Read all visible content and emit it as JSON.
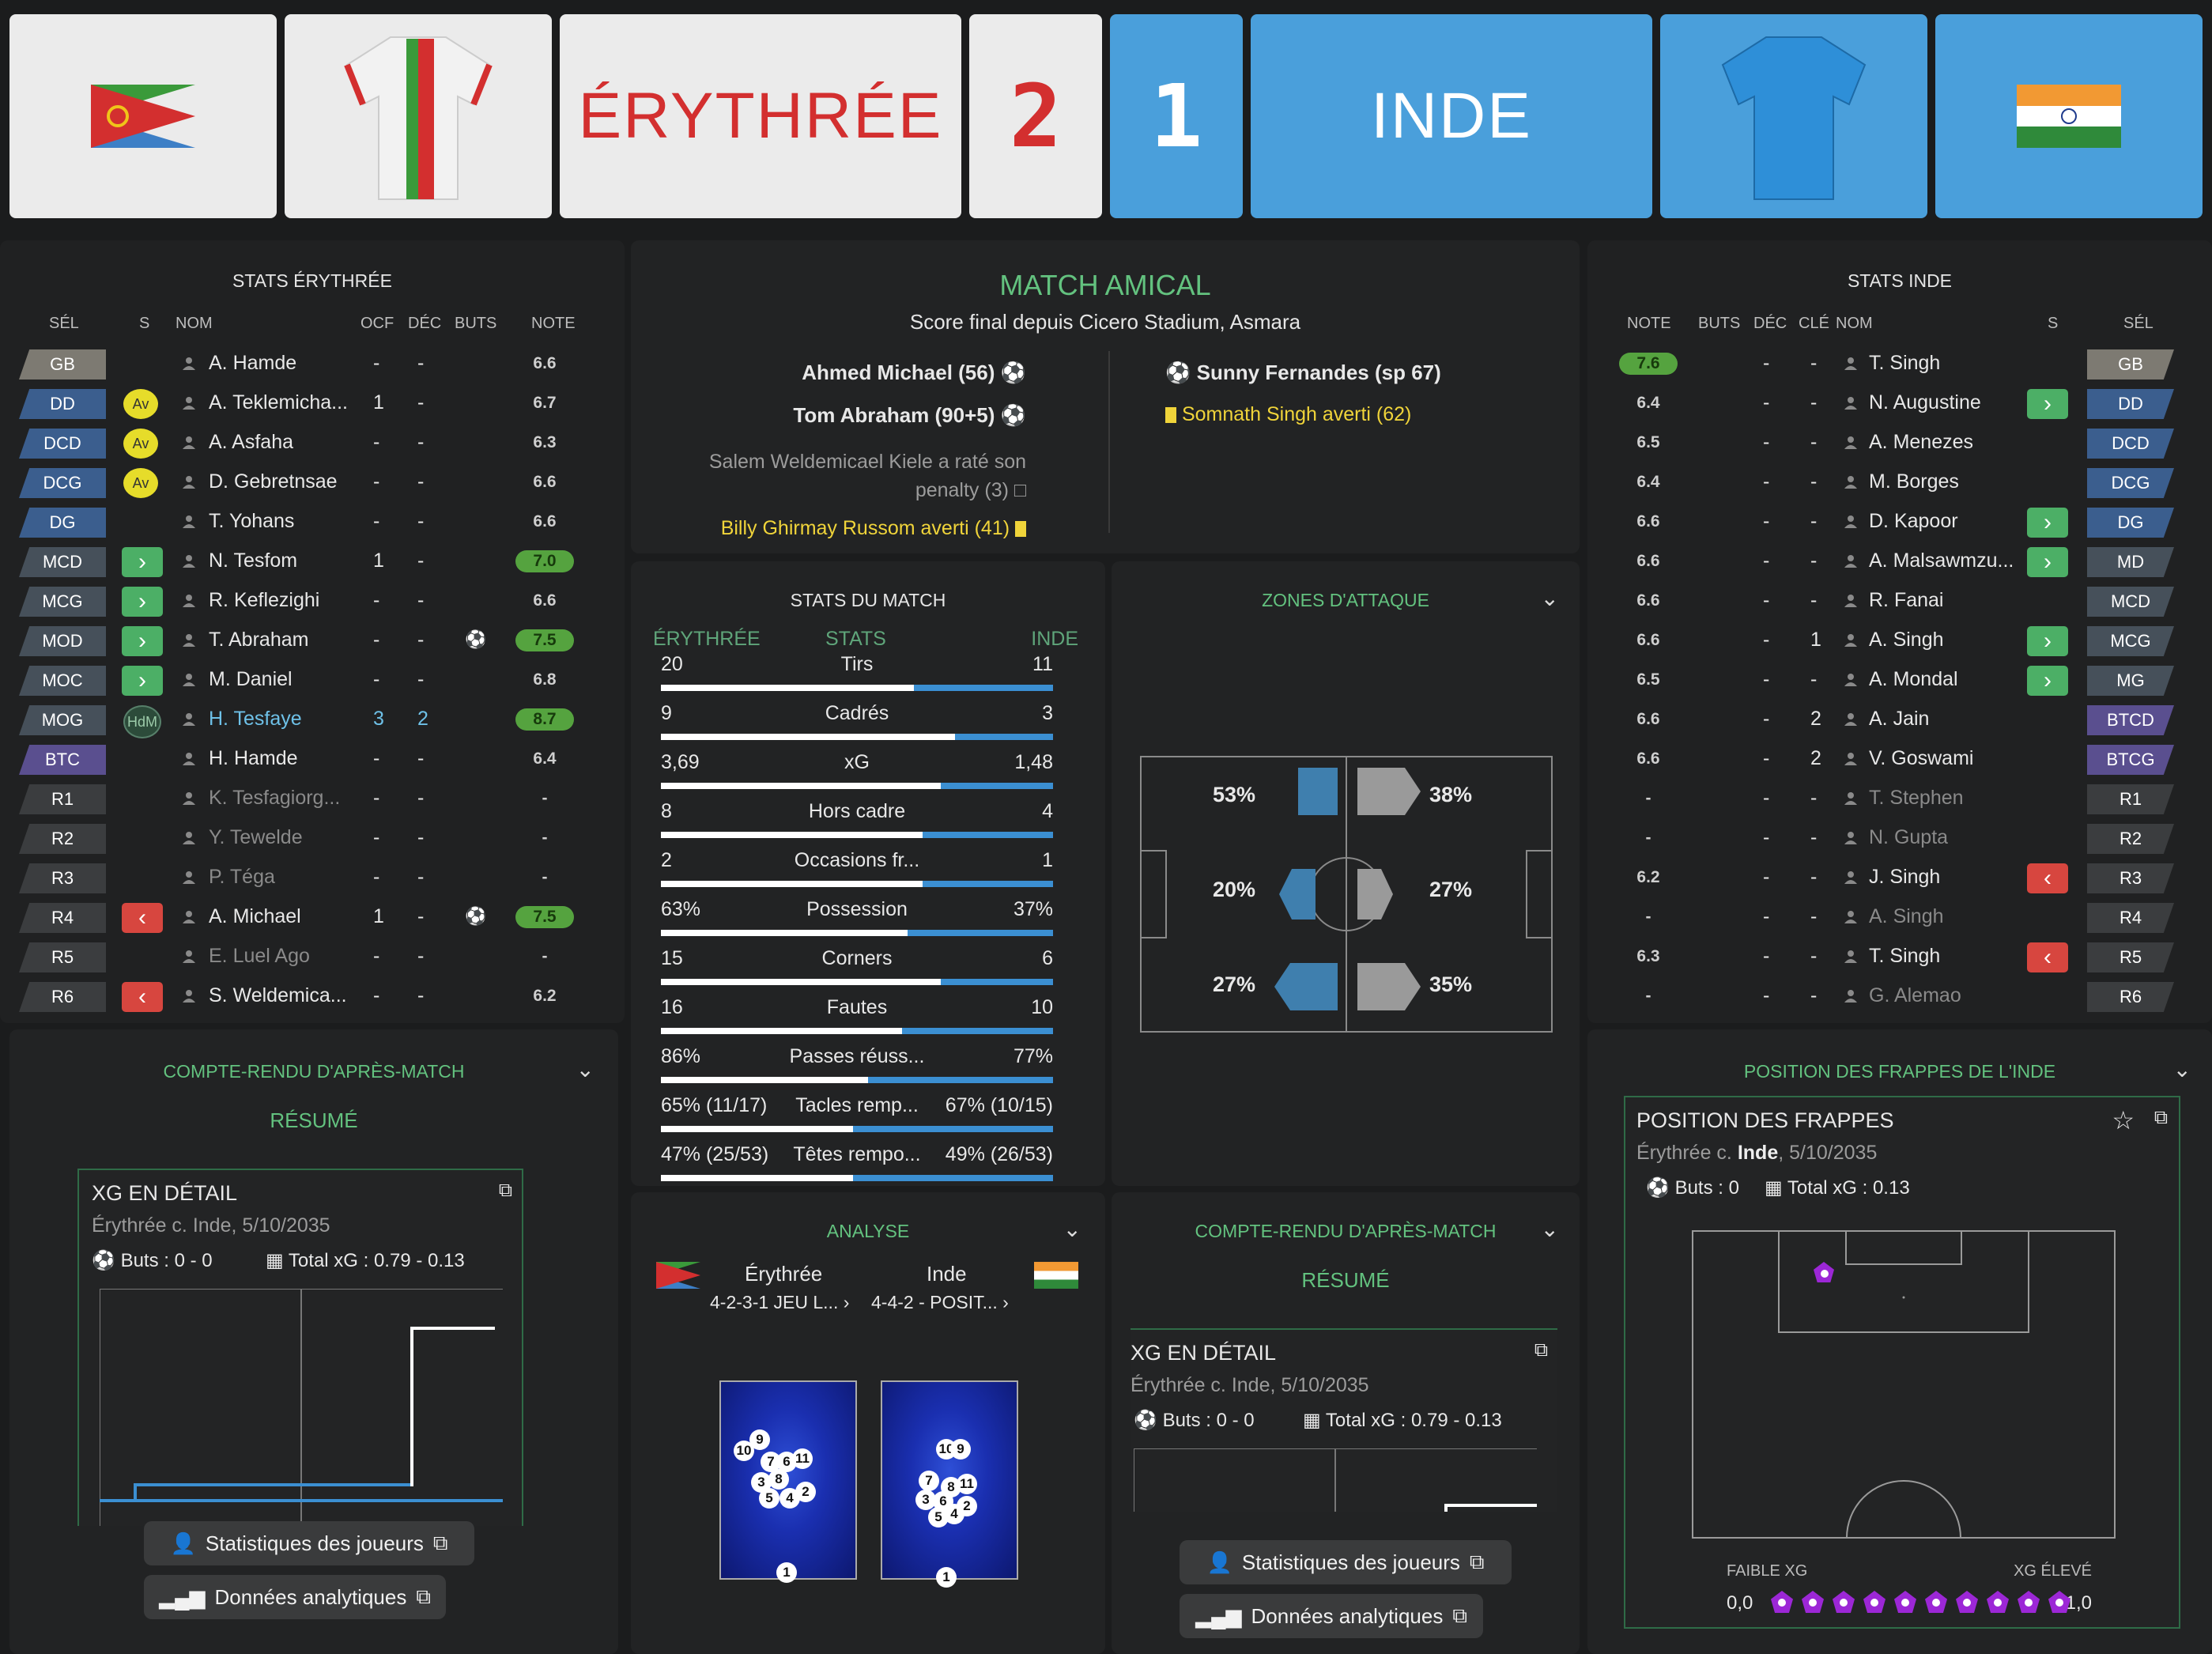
{
  "header": {
    "home_name": "ÉRYTHRÉE",
    "home_score": "2",
    "away_score": "1",
    "away_name": "INDE"
  },
  "home_stats": {
    "title": "STATS ÉRYTHRÉE",
    "columns": {
      "sel": "SÉL",
      "s": "S",
      "nom": "NOM",
      "ocf": "OCF",
      "dec": "DÉC",
      "buts": "BUTS",
      "note": "NOTE"
    },
    "players": [
      {
        "pos": "GB",
        "badge": "",
        "name": "A. Hamde",
        "ocf": "-",
        "dec": "-",
        "buts": "",
        "note": "6.6",
        "type": "gk"
      },
      {
        "pos": "DD",
        "badge": "Av",
        "name": "A. Teklemicha...",
        "ocf": "1",
        "dec": "-",
        "buts": "",
        "note": "6.7",
        "type": "def"
      },
      {
        "pos": "DCD",
        "badge": "Av",
        "name": "A. Asfaha",
        "ocf": "-",
        "dec": "-",
        "buts": "",
        "note": "6.3",
        "type": "def"
      },
      {
        "pos": "DCG",
        "badge": "Av",
        "name": "D. Gebretnsae",
        "ocf": "-",
        "dec": "-",
        "buts": "",
        "note": "6.6",
        "type": "def"
      },
      {
        "pos": "DG",
        "badge": "",
        "name": "T. Yohans",
        "ocf": "-",
        "dec": "-",
        "buts": "",
        "note": "6.6",
        "type": "def"
      },
      {
        "pos": "MCD",
        "badge": "in",
        "name": "N. Tesfom",
        "ocf": "1",
        "dec": "-",
        "buts": "",
        "note": "7.0",
        "type": "mid"
      },
      {
        "pos": "MCG",
        "badge": "in",
        "name": "R. Keflezighi",
        "ocf": "-",
        "dec": "-",
        "buts": "",
        "note": "6.6",
        "type": "mid"
      },
      {
        "pos": "MOD",
        "badge": "in",
        "name": "T. Abraham",
        "ocf": "-",
        "dec": "-",
        "buts": "ball",
        "note": "7.5",
        "type": "mid"
      },
      {
        "pos": "MOC",
        "badge": "in",
        "name": "M. Daniel",
        "ocf": "-",
        "dec": "-",
        "buts": "",
        "note": "6.8",
        "type": "mid"
      },
      {
        "pos": "MOG",
        "badge": "HdM",
        "name": "H. Tesfaye",
        "ocf": "3",
        "dec": "2",
        "buts": "",
        "note": "8.7",
        "type": "mid"
      },
      {
        "pos": "BTC",
        "badge": "",
        "name": "H. Hamde",
        "ocf": "-",
        "dec": "-",
        "buts": "",
        "note": "6.4",
        "type": "fwd"
      },
      {
        "pos": "R1",
        "badge": "",
        "name": "K. Tesfagiorg...",
        "ocf": "-",
        "dec": "-",
        "buts": "",
        "note": "-",
        "type": "sub"
      },
      {
        "pos": "R2",
        "badge": "",
        "name": "Y. Tewelde",
        "ocf": "-",
        "dec": "-",
        "buts": "",
        "note": "-",
        "type": "sub"
      },
      {
        "pos": "R3",
        "badge": "",
        "name": "P. Téga",
        "ocf": "-",
        "dec": "-",
        "buts": "",
        "note": "-",
        "type": "sub"
      },
      {
        "pos": "R4",
        "badge": "out",
        "name": "A. Michael",
        "ocf": "1",
        "dec": "-",
        "buts": "ball",
        "note": "7.5",
        "type": "sub"
      },
      {
        "pos": "R5",
        "badge": "",
        "name": "E. Luel Ago",
        "ocf": "-",
        "dec": "-",
        "buts": "",
        "note": "-",
        "type": "sub"
      },
      {
        "pos": "R6",
        "badge": "out",
        "name": "S. Weldemica...",
        "ocf": "-",
        "dec": "-",
        "buts": "",
        "note": "6.2",
        "type": "sub"
      }
    ]
  },
  "away_stats": {
    "title": "STATS INDE",
    "columns": {
      "note": "NOTE",
      "buts": "BUTS",
      "dec": "DÉC",
      "cle": "CLÉ",
      "nom": "NOM",
      "s": "S",
      "sel": "SÉL"
    },
    "players": [
      {
        "note": "7.6",
        "buts": "",
        "dec": "-",
        "cle": "-",
        "name": "T. Singh",
        "badge": "",
        "pos": "GB",
        "type": "gk"
      },
      {
        "note": "6.4",
        "buts": "",
        "dec": "-",
        "cle": "-",
        "name": "N. Augustine",
        "badge": "in",
        "pos": "DD",
        "type": "def"
      },
      {
        "note": "6.5",
        "buts": "",
        "dec": "-",
        "cle": "-",
        "name": "A. Menezes",
        "badge": "",
        "pos": "DCD",
        "type": "def"
      },
      {
        "note": "6.4",
        "buts": "",
        "dec": "-",
        "cle": "-",
        "name": "M. Borges",
        "badge": "",
        "pos": "DCG",
        "type": "def"
      },
      {
        "note": "6.6",
        "buts": "",
        "dec": "-",
        "cle": "-",
        "name": "D. Kapoor",
        "badge": "in",
        "pos": "DG",
        "type": "def"
      },
      {
        "note": "6.6",
        "buts": "",
        "dec": "-",
        "cle": "-",
        "name": "A. Malsawmzu...",
        "badge": "in",
        "pos": "MD",
        "type": "mid"
      },
      {
        "note": "6.6",
        "buts": "",
        "dec": "-",
        "cle": "-",
        "name": "R. Fanai",
        "badge": "",
        "pos": "MCD",
        "type": "mid"
      },
      {
        "note": "6.6",
        "buts": "",
        "dec": "-",
        "cle": "1",
        "name": "A. Singh",
        "badge": "in",
        "pos": "MCG",
        "type": "mid"
      },
      {
        "note": "6.5",
        "buts": "",
        "dec": "-",
        "cle": "-",
        "name": "A. Mondal",
        "badge": "in",
        "pos": "MG",
        "type": "mid"
      },
      {
        "note": "6.6",
        "buts": "",
        "dec": "-",
        "cle": "2",
        "name": "A. Jain",
        "badge": "",
        "pos": "BTCD",
        "type": "fwd"
      },
      {
        "note": "6.6",
        "buts": "",
        "dec": "-",
        "cle": "2",
        "name": "V. Goswami",
        "badge": "",
        "pos": "BTCG",
        "type": "fwd"
      },
      {
        "note": "-",
        "buts": "",
        "dec": "-",
        "cle": "-",
        "name": "T. Stephen",
        "badge": "",
        "pos": "R1",
        "type": "sub"
      },
      {
        "note": "-",
        "buts": "",
        "dec": "-",
        "cle": "-",
        "name": "N. Gupta",
        "badge": "",
        "pos": "R2",
        "type": "sub"
      },
      {
        "note": "6.2",
        "buts": "",
        "dec": "-",
        "cle": "-",
        "name": "J. Singh",
        "badge": "out",
        "pos": "R3",
        "type": "sub"
      },
      {
        "note": "-",
        "buts": "",
        "dec": "-",
        "cle": "-",
        "name": "A. Singh",
        "badge": "",
        "pos": "R4",
        "type": "sub"
      },
      {
        "note": "6.3",
        "buts": "",
        "dec": "-",
        "cle": "-",
        "name": "T. Singh",
        "badge": "out",
        "pos": "R5",
        "type": "sub"
      },
      {
        "note": "-",
        "buts": "",
        "dec": "-",
        "cle": "-",
        "name": "G. Alemao",
        "badge": "",
        "pos": "R6",
        "type": "sub"
      }
    ]
  },
  "match": {
    "title": "MATCH AMICAL",
    "subtitle": "Score final depuis Cicero Stadium, Asmara",
    "home_events": [
      "Ahmed Michael (56)",
      "Tom Abraham (90+5)",
      "Salem Weldemicael Kiele a raté son penalty (3)",
      "Billy Ghirmay Russom averti (41)"
    ],
    "away_events": [
      "Sunny Fernandes (sp 67)",
      "Somnath Singh averti (62)"
    ]
  },
  "match_stats": {
    "title": "STATS DU MATCH",
    "home_label": "ÉRYTHRÉE",
    "stats_label": "STATS",
    "away_label": "INDE",
    "rows": [
      {
        "home": "20",
        "label": "Tirs",
        "away": "11",
        "home_share": 0.645
      },
      {
        "home": "9",
        "label": "Cadrés",
        "away": "3",
        "home_share": 0.75
      },
      {
        "home": "3,69",
        "label": "xG",
        "away": "1,48",
        "home_share": 0.714
      },
      {
        "home": "8",
        "label": "Hors cadre",
        "away": "4",
        "home_share": 0.667
      },
      {
        "home": "2",
        "label": "Occasions fr...",
        "away": "1",
        "home_share": 0.667
      },
      {
        "home": "63%",
        "label": "Possession",
        "away": "37%",
        "home_share": 0.63
      },
      {
        "home": "15",
        "label": "Corners",
        "away": "6",
        "home_share": 0.714
      },
      {
        "home": "16",
        "label": "Fautes",
        "away": "10",
        "home_share": 0.615
      },
      {
        "home": "86%",
        "label": "Passes réuss...",
        "away": "77%",
        "home_share": 0.528
      },
      {
        "home": "65% (11/17)",
        "label": "Tacles remp...",
        "away": "67% (10/15)",
        "home_share": 0.49
      },
      {
        "home": "47% (25/53)",
        "label": "Têtes rempo...",
        "away": "49% (26/53)",
        "home_share": 0.49
      }
    ]
  },
  "attack_zones": {
    "title": "ZONES D'ATTAQUE",
    "home": {
      "left": "53%",
      "center": "20%",
      "right": "27%"
    },
    "away": {
      "left": "38%",
      "center": "27%",
      "right": "35%"
    }
  },
  "left_report": {
    "title": "COMPTE-RENDU D'APRÈS-MATCH",
    "tab": "RÉSUMÉ",
    "card_title": "XG EN DÉTAIL",
    "card_sub": "Érythrée c. Inde, 5/10/2035",
    "goals": "Buts : 0 - 0",
    "xg": "Total xG : 0.79 - 0.13",
    "btn_players": "Statistiques des joueurs",
    "btn_data": "Données analytiques"
  },
  "analysis": {
    "title": "ANALYSE",
    "home_team": "Érythrée",
    "home_form": "4-2-3-1 JEU L...",
    "away_team": "Inde",
    "away_form": "4-4-2 - POSIT...",
    "home_numbers": [
      "10",
      "9",
      "7",
      "6",
      "11",
      "3",
      "8",
      "5",
      "4",
      "2",
      "1"
    ],
    "away_numbers": [
      "10",
      "9",
      "7",
      "8",
      "11",
      "3",
      "6",
      "5",
      "4",
      "2",
      "1"
    ]
  },
  "mid_report": {
    "title": "COMPTE-RENDU D'APRÈS-MATCH",
    "tab": "RÉSUMÉ",
    "card_title": "XG EN DÉTAIL",
    "card_sub": "Érythrée c. Inde, 5/10/2035",
    "goals": "Buts : 0 - 0",
    "xg": "Total xG : 0.79 - 0.13",
    "btn_players": "Statistiques des joueurs",
    "btn_data": "Données analytiques"
  },
  "shots": {
    "title": "POSITION DES FRAPPES DE L'INDE",
    "card_title": "POSITION DES FRAPPES",
    "card_sub_pre": "Érythrée c. ",
    "card_sub_bold": "Inde",
    "card_sub_post": ", 5/10/2035",
    "goals": "Buts : 0",
    "xg": "Total xG : 0.13",
    "low": "FAIBLE XG",
    "high": "XG ÉLEVÉ",
    "min": "0,0",
    "max": "1,0"
  },
  "colors": {
    "home_red": "#d32f2f",
    "away_blue": "#4a9fdb",
    "accent_green": "#63c27f"
  }
}
